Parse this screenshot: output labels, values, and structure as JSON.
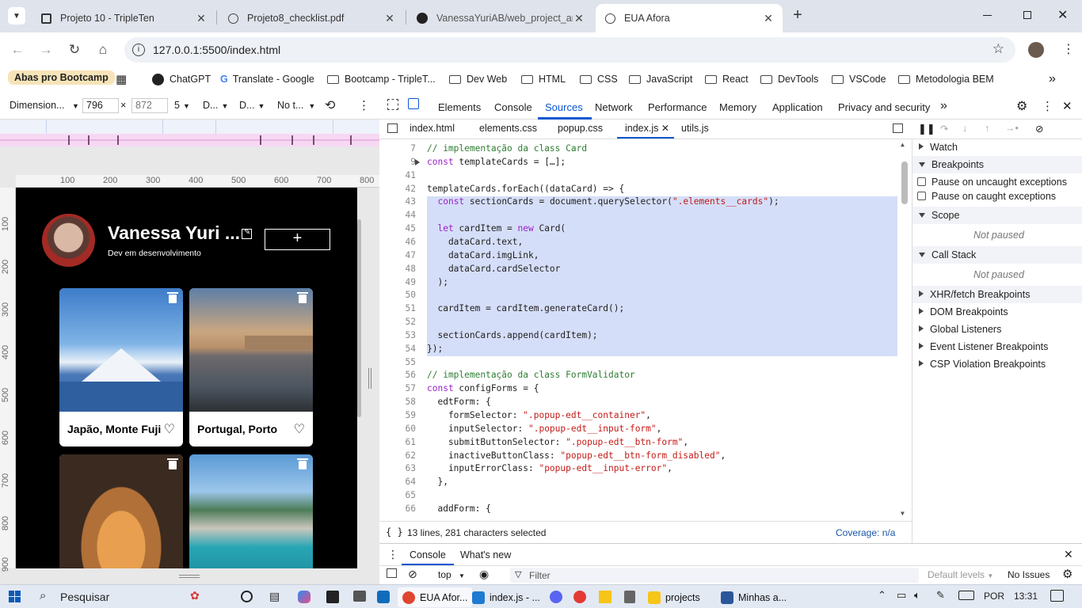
{
  "browser": {
    "tabs": [
      {
        "label": "Projeto 10 - TripleTen",
        "icon": "tripleten-icon"
      },
      {
        "label": "Projeto8_checklist.pdf",
        "icon": "globe-icon"
      },
      {
        "label": "VanessaYuriAB/web_project_aro",
        "icon": "github-icon"
      },
      {
        "label": "EUA Afora",
        "icon": "globe-icon",
        "active": true
      }
    ],
    "new_tab": "+",
    "url": "127.0.0.1:5500/index.html",
    "bookmarks": [
      {
        "label": "Abas pro Bootcamp",
        "type": "tab-group"
      },
      {
        "label": "ChatGPT",
        "type": "site"
      },
      {
        "label": "Translate - Google",
        "type": "site"
      },
      {
        "label": "Bootcamp - TripleT...",
        "type": "folder"
      },
      {
        "label": "Dev Web",
        "type": "folder"
      },
      {
        "label": "HTML",
        "type": "folder"
      },
      {
        "label": "CSS",
        "type": "folder"
      },
      {
        "label": "JavaScript",
        "type": "folder"
      },
      {
        "label": "React",
        "type": "folder"
      },
      {
        "label": "DevTools",
        "type": "folder"
      },
      {
        "label": "VSCode",
        "type": "folder"
      },
      {
        "label": "Metodologia BEM",
        "type": "folder"
      }
    ],
    "more_bookmarks": "»"
  },
  "device_toolbar": {
    "dimensions": "Dimension...",
    "width": "796",
    "times": "×",
    "height": "872",
    "zoom": "5",
    "dpr": "D...",
    "device": "D...",
    "throttle": "No t...",
    "ruler_h": [
      "100",
      "200",
      "300",
      "400",
      "500",
      "600",
      "700",
      "800"
    ],
    "ruler_v": [
      "100",
      "200",
      "300",
      "400",
      "500",
      "600",
      "700",
      "800",
      "900"
    ]
  },
  "site": {
    "profile_name": "Vanessa Yuri ...",
    "profile_about": "Dev em desenvolvimento",
    "add_button": "+",
    "cards": [
      {
        "title": "Japão, Monte Fuji"
      },
      {
        "title": "Portugal, Porto"
      },
      {
        "title": ""
      },
      {
        "title": ""
      }
    ]
  },
  "devtools": {
    "tabs": [
      "Elements",
      "Console",
      "Sources",
      "Network",
      "Performance",
      "Memory",
      "Application",
      "Privacy and security"
    ],
    "active_tab": "Sources",
    "more_tabs": "»",
    "files": [
      "index.html",
      "elements.css",
      "popup.css",
      "index.js",
      "utils.js"
    ],
    "active_file": "index.js",
    "code_lines": [
      {
        "n": "7",
        "t": "// implementação da class Card"
      },
      {
        "n": "9",
        "t": "const templateCards = […];"
      },
      {
        "n": "41",
        "t": ""
      },
      {
        "n": "42",
        "t": "templateCards.forEach((dataCard) => {"
      },
      {
        "n": "43",
        "t": "  const sectionCards = document.querySelector(\".elements__cards\");"
      },
      {
        "n": "44",
        "t": ""
      },
      {
        "n": "45",
        "t": "  let cardItem = new Card("
      },
      {
        "n": "46",
        "t": "    dataCard.text,"
      },
      {
        "n": "47",
        "t": "    dataCard.imgLink,"
      },
      {
        "n": "48",
        "t": "    dataCard.cardSelector"
      },
      {
        "n": "49",
        "t": "  );"
      },
      {
        "n": "50",
        "t": ""
      },
      {
        "n": "51",
        "t": "  cardItem = cardItem.generateCard();"
      },
      {
        "n": "52",
        "t": ""
      },
      {
        "n": "53",
        "t": "  sectionCards.append(cardItem);"
      },
      {
        "n": "54",
        "t": "});"
      },
      {
        "n": "55",
        "t": ""
      },
      {
        "n": "56",
        "t": "// implementação da class FormValidator"
      },
      {
        "n": "57",
        "t": "const configForms = {"
      },
      {
        "n": "58",
        "t": "  edtForm: {"
      },
      {
        "n": "59",
        "t": "    formSelector: \".popup-edt__container\","
      },
      {
        "n": "60",
        "t": "    inputSelector: \".popup-edt__input-form\","
      },
      {
        "n": "61",
        "t": "    submitButtonSelector: \".popup-edt__btn-form\","
      },
      {
        "n": "62",
        "t": "    inactiveButtonClass: \"popup-edt__btn-form_disabled\","
      },
      {
        "n": "63",
        "t": "    inputErrorClass: \"popup-edt__input-error\","
      },
      {
        "n": "64",
        "t": "  },"
      },
      {
        "n": "65",
        "t": ""
      },
      {
        "n": "66",
        "t": "  addForm: {"
      }
    ],
    "status_left": "13 lines, 281 characters selected",
    "status_right": "Coverage: n/a",
    "status_braces": "{ }",
    "right_panel": {
      "watch": "Watch",
      "breakpoints": "Breakpoints",
      "pause_uncaught": "Pause on uncaught exceptions",
      "pause_caught": "Pause on caught exceptions",
      "scope": "Scope",
      "scope_status": "Not paused",
      "callstack": "Call Stack",
      "callstack_status": "Not paused",
      "xhr": "XHR/fetch Breakpoints",
      "dom": "DOM Breakpoints",
      "global": "Global Listeners",
      "event": "Event Listener Breakpoints",
      "csp": "CSP Violation Breakpoints"
    },
    "drawer": {
      "tab_console": "Console",
      "tab_whatsnew": "What's new",
      "context": "top",
      "filter_placeholder": "Filter",
      "levels": "Default levels",
      "issues": "No Issues"
    }
  },
  "taskbar": {
    "search": "Pesquisar",
    "apps": [
      {
        "label": "EUA Afor...",
        "color": "#e0452f"
      },
      {
        "label": "index.js - ...",
        "color": "#1f7ad1"
      },
      {
        "label": "projects",
        "color": "#f5c518"
      },
      {
        "label": "Minhas a...",
        "color": "#2b579a"
      }
    ],
    "lang": "POR",
    "time": "13:31"
  }
}
